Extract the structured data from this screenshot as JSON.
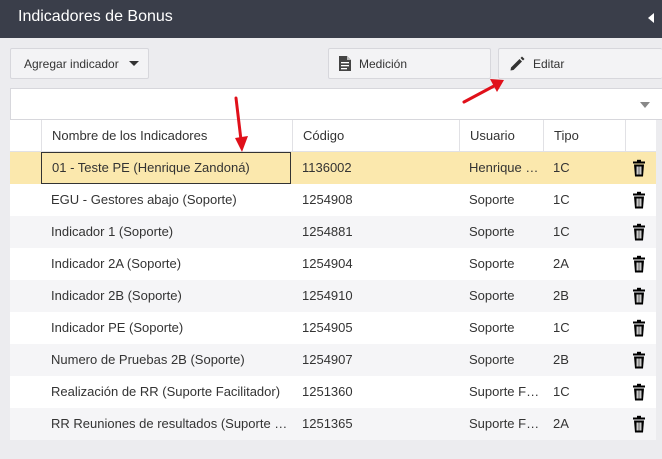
{
  "window": {
    "title": "Indicadores de Bonus"
  },
  "toolbar": {
    "agregar_label": "Agregar indicador",
    "medicion_label": "Medición",
    "editar_label": "Editar"
  },
  "filter": {
    "value": ""
  },
  "table": {
    "headers": [
      "Nombre de los Indicadores",
      "Código",
      "Usuario",
      "Tipo"
    ],
    "rows": [
      {
        "name": "01 - Teste PE (Henrique Zandoná)",
        "code": "1136002",
        "user": "Henrique Zandoná",
        "type": "1C",
        "selected": true
      },
      {
        "name": "EGU - Gestores abajo (Soporte)",
        "code": "1254908",
        "user": "Soporte",
        "type": "1C"
      },
      {
        "name": "Indicador 1 (Soporte)",
        "code": "1254881",
        "user": "Soporte",
        "type": "1C"
      },
      {
        "name": "Indicador 2A (Soporte)",
        "code": "1254904",
        "user": "Soporte",
        "type": "2A"
      },
      {
        "name": "Indicador 2B (Soporte)",
        "code": "1254910",
        "user": "Soporte",
        "type": "2B"
      },
      {
        "name": "Indicador PE (Soporte)",
        "code": "1254905",
        "user": "Soporte",
        "type": "1C"
      },
      {
        "name": "Numero de Pruebas 2B (Soporte)",
        "code": "1254907",
        "user": "Soporte",
        "type": "2B"
      },
      {
        "name": "Realización de RR (Suporte Facilitador)",
        "code": "1251360",
        "user": "Suporte Facilitador",
        "type": "1C"
      },
      {
        "name": "RR Reuniones de resultados (Suporte Facilitador)",
        "code": "1251365",
        "user": "Suporte Facilitador",
        "type": "2A"
      }
    ]
  },
  "colors": {
    "header_bg": "#3a3e4a",
    "selected_row": "#fbe8ad",
    "annotation_arrow": "#e0101a"
  }
}
